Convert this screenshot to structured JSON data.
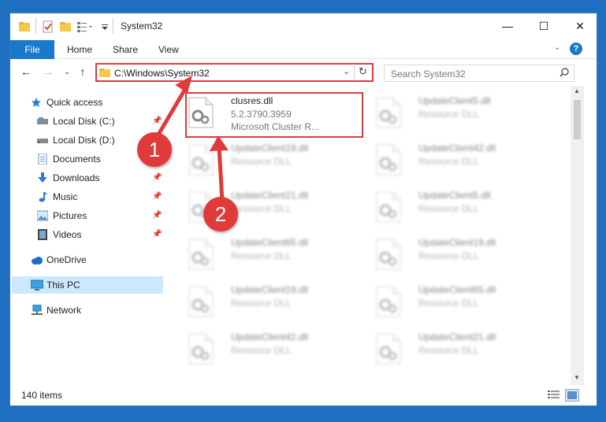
{
  "window": {
    "title": "System32",
    "minimize": "—",
    "maximize": "☐",
    "close": "✕"
  },
  "ribbon": {
    "tabs": [
      "File",
      "Home",
      "Share",
      "View"
    ],
    "help": "?"
  },
  "address_bar": {
    "path": "C:\\Windows\\System32",
    "search_placeholder": "Search System32"
  },
  "sidebar": {
    "items": [
      {
        "label": "Quick access",
        "icon": "star-icon",
        "pinned": false
      },
      {
        "label": "Local Disk (C:)",
        "icon": "drive-icon",
        "pinned": true
      },
      {
        "label": "Local Disk (D:)",
        "icon": "drive-icon",
        "pinned": false
      },
      {
        "label": "Documents",
        "icon": "documents-icon",
        "pinned": true
      },
      {
        "label": "Downloads",
        "icon": "download-icon",
        "pinned": true
      },
      {
        "label": "Music",
        "icon": "music-icon",
        "pinned": true
      },
      {
        "label": "Pictures",
        "icon": "pictures-icon",
        "pinned": true
      },
      {
        "label": "Videos",
        "icon": "videos-icon",
        "pinned": true
      },
      {
        "label": "OneDrive",
        "icon": "cloud-icon",
        "pinned": false
      },
      {
        "label": "This PC",
        "icon": "computer-icon",
        "pinned": false,
        "selected": true
      },
      {
        "label": "Network",
        "icon": "network-icon",
        "pinned": false
      }
    ]
  },
  "files": [
    {
      "name": "clusres.dll",
      "version": "5.2.3790.3959",
      "description": "Microsoft Cluster R...",
      "highlighted": true
    },
    {
      "name": "UpdateClient5.dll",
      "description": "Resource DLL"
    },
    {
      "name": "UpdateClient19.dll",
      "description": "Resource DLL"
    },
    {
      "name": "UpdateClient42.dll",
      "description": "Resource DLL"
    },
    {
      "name": "UpdateClient21.dll",
      "description": "Resource DLL"
    },
    {
      "name": "UpdateClient5.dll",
      "description": "Resource DLL"
    },
    {
      "name": "UpdateClient65.dll",
      "description": "Resource DLL"
    },
    {
      "name": "UpdateClient19.dll",
      "description": "Resource DLL"
    },
    {
      "name": "UpdateClient19.dll",
      "description": "Resource DLL"
    },
    {
      "name": "UpdateClient65.dll",
      "description": "Resource DLL"
    },
    {
      "name": "UpdateClient42.dll",
      "description": "Resource DLL"
    },
    {
      "name": "UpdateClient21.dll",
      "description": "Resource DLL"
    }
  ],
  "status": {
    "item_count": "140 items"
  },
  "annotations": {
    "step1": "1",
    "step2": "2"
  },
  "colors": {
    "accent": "#1979ca",
    "highlight": "#e03a3a",
    "selected": "#cce8ff"
  }
}
